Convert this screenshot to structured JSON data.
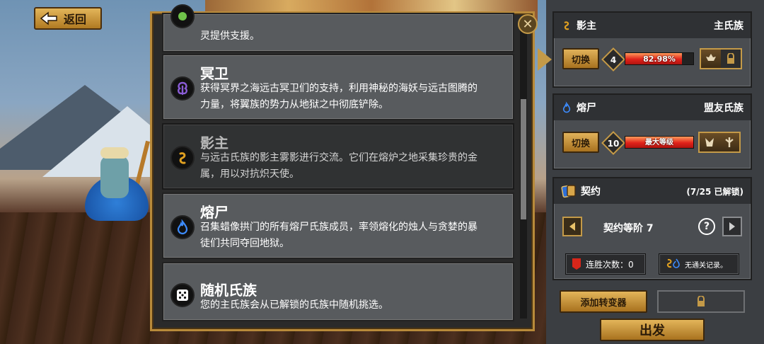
{
  "back": {
    "label": "返回",
    "icon": "arrow-left-icon"
  },
  "clans": [
    {
      "title": "",
      "desc": "灵提供支援。",
      "icon": "green-clan-icon"
    },
    {
      "title": "冥卫",
      "desc": "获得冥界之海远古冥卫们的支持，利用神秘的海妖与远古图腾的力量，将翼族的势力从地狱之中彻底铲除。",
      "icon": "purple-tentacle-icon",
      "color": "#8a5cd6"
    },
    {
      "title": "影主",
      "desc": "与远古氏族的影主雾影进行交流。它们在熔炉之地采集珍贵的金属，用以对抗炽天使。",
      "icon": "gold-swirl-icon",
      "color": "#e0a020",
      "selected": true
    },
    {
      "title": "熔尸",
      "desc": "召集蜡像拱门的所有熔尸氏族成员，率领熔化的烛人与贪婪的暴徒们共同夺回地狱。",
      "icon": "blue-flame-icon",
      "color": "#3d8cff"
    },
    {
      "title": "随机氏族",
      "desc": "您的主氏族会从已解锁的氏族中随机挑选。",
      "icon": "dice-icon"
    }
  ],
  "primary": {
    "name": "影主",
    "role": "主氏族",
    "swap_label": "切换",
    "level": "4",
    "progress_text": "82.98%",
    "progress": 0.8298
  },
  "ally": {
    "name": "熔尸",
    "role": "盟友氏族",
    "swap_label": "切换",
    "level": "10",
    "progress_text": "最大等级",
    "progress": 1.0
  },
  "contract": {
    "title": "契约",
    "unlocked": "(7/25 已解锁)",
    "rank_label": "契约等阶 7",
    "help": "?",
    "streak_label": "连胜次数：0",
    "record_label": "无通关记录。"
  },
  "actions": {
    "add_mutator": "添加转变器",
    "depart": "出发"
  },
  "colors": {
    "gold": "#c49a48",
    "panel": "#585b5e",
    "selected_card": "#303233",
    "bar_red": "#e0221a"
  }
}
